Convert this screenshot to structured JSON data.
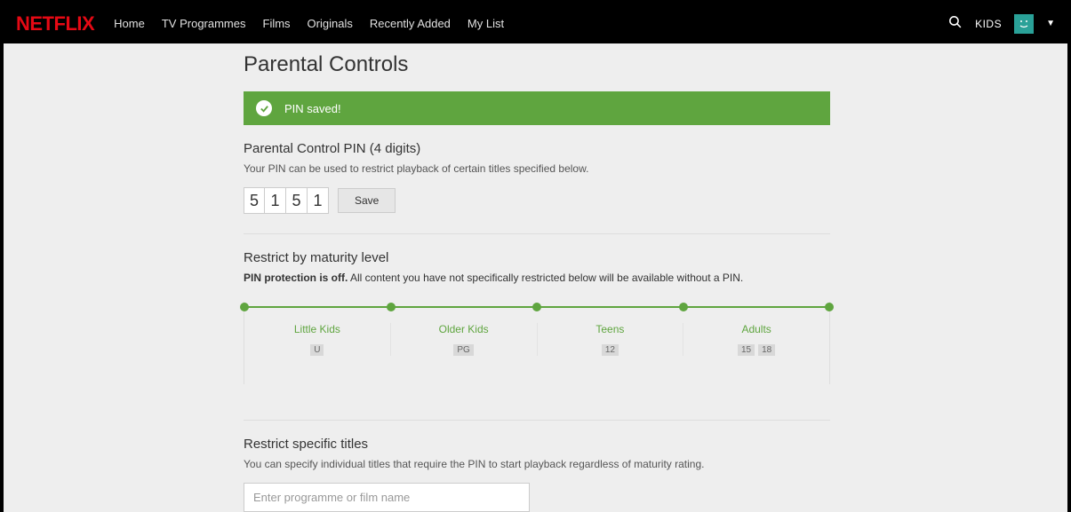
{
  "topbar": {
    "logo": "NETFLIX",
    "nav": [
      "Home",
      "TV Programmes",
      "Films",
      "Originals",
      "Recently Added",
      "My List"
    ],
    "kids": "KIDS"
  },
  "page": {
    "title": "Parental Controls"
  },
  "banner": {
    "message": "PIN saved!"
  },
  "pin_section": {
    "heading": "Parental Control PIN (4 digits)",
    "desc": "Your PIN can be used to restrict playback of certain titles specified below.",
    "digits": [
      "5",
      "1",
      "5",
      "1"
    ],
    "save": "Save"
  },
  "maturity_section": {
    "heading": "Restrict by maturity level",
    "protection_strong": "PIN protection is off.",
    "protection_rest": " All content you have not specifically restricted below will be available without a PIN.",
    "levels": [
      {
        "label": "Little Kids",
        "badges": [
          "U"
        ]
      },
      {
        "label": "Older Kids",
        "badges": [
          "PG"
        ]
      },
      {
        "label": "Teens",
        "badges": [
          "12"
        ]
      },
      {
        "label": "Adults",
        "badges": [
          "15",
          "18"
        ]
      }
    ]
  },
  "titles_section": {
    "heading": "Restrict specific titles",
    "desc": "You can specify individual titles that require the PIN to start playback regardless of maturity rating.",
    "placeholder": "Enter programme or film name"
  }
}
